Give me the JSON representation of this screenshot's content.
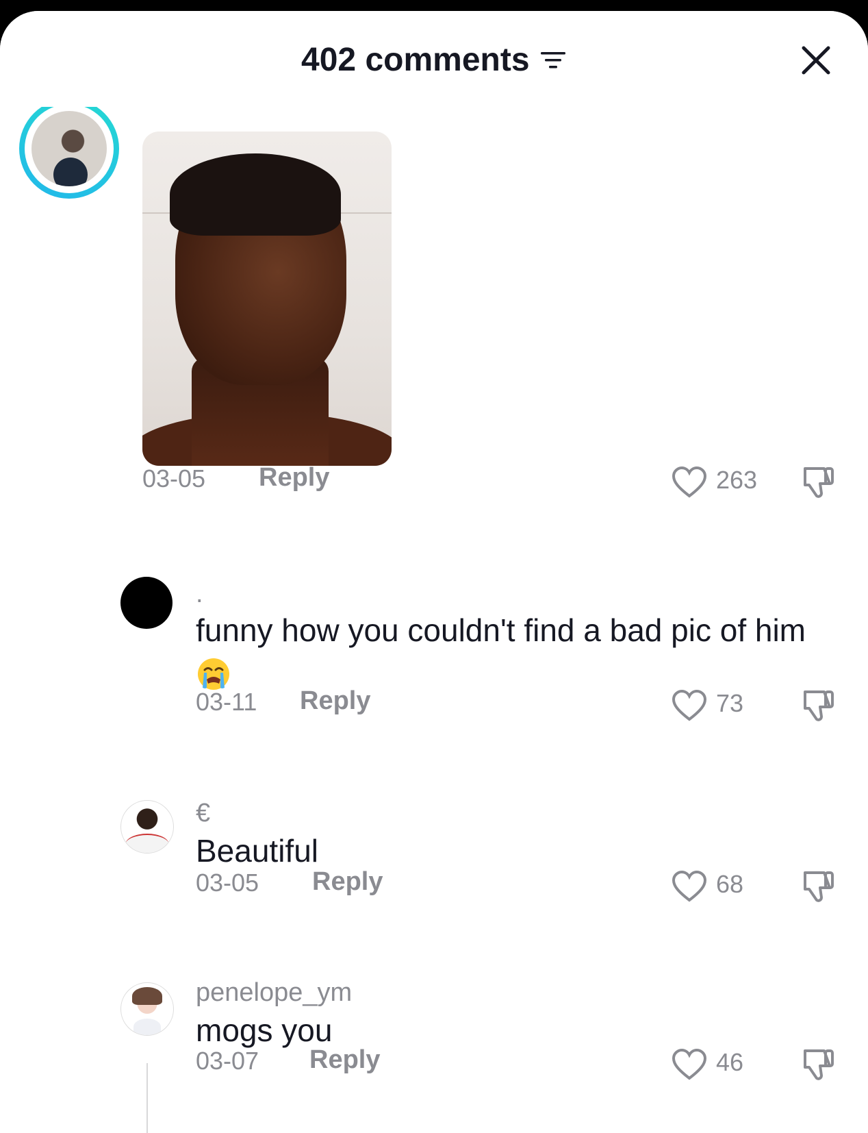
{
  "header": {
    "title": "402 comments"
  },
  "comments": [
    {
      "date": "03-05",
      "reply_label": "Reply",
      "likes": "263"
    },
    {
      "username": ".",
      "text": "funny how you couldn't find a bad pic of him",
      "date": "03-11",
      "reply_label": "Reply",
      "likes": "73"
    },
    {
      "username": "€",
      "text": "Beautiful",
      "date": "03-05",
      "reply_label": "Reply",
      "likes": "68"
    },
    {
      "username": "penelope_ym",
      "text": "mogs you",
      "date": "03-07",
      "reply_label": "Reply",
      "likes": "46"
    }
  ],
  "colors": {
    "text_primary": "#161823",
    "text_secondary": "#8a8b91",
    "ring_accent": "#25d9d2"
  },
  "icons": [
    "filter-icon",
    "close-icon",
    "heart-icon",
    "dislike-icon",
    "loudly-crying-emoji"
  ]
}
